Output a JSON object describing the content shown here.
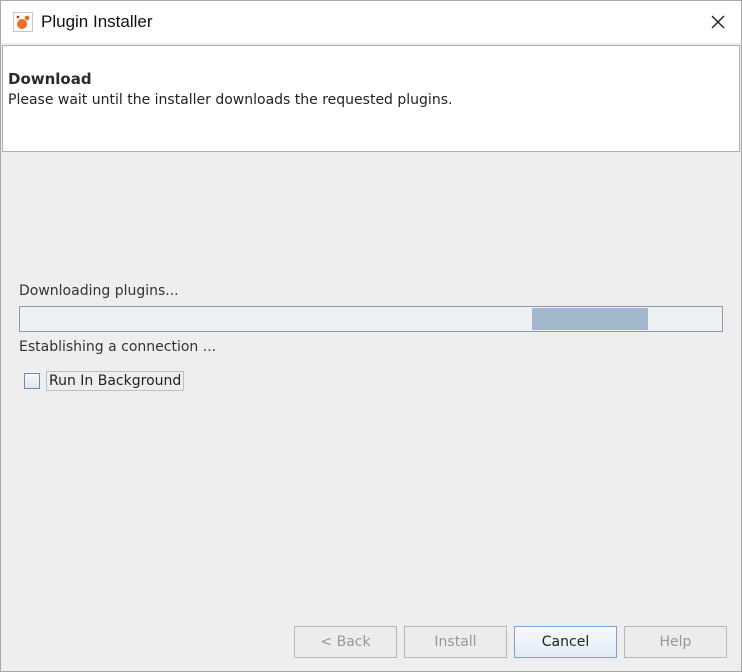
{
  "window": {
    "title": "Plugin Installer"
  },
  "header": {
    "title": "Download",
    "description": "Please wait until the installer downloads the requested plugins."
  },
  "body": {
    "status_label": "Downloading plugins...",
    "progress": {
      "indeterminate": true,
      "fill_color": "#a3b8cc"
    },
    "detail_label": "Establishing a connection ...",
    "run_in_background": {
      "label": "Run In Background",
      "checked": false
    }
  },
  "buttons": {
    "back": {
      "label": "< Back",
      "enabled": false
    },
    "install": {
      "label": "Install",
      "enabled": false
    },
    "cancel": {
      "label": "Cancel",
      "enabled": true
    },
    "help": {
      "label": "Help",
      "enabled": false
    }
  },
  "icons": {
    "app": "plugin-installer-icon",
    "close": "close-icon"
  }
}
